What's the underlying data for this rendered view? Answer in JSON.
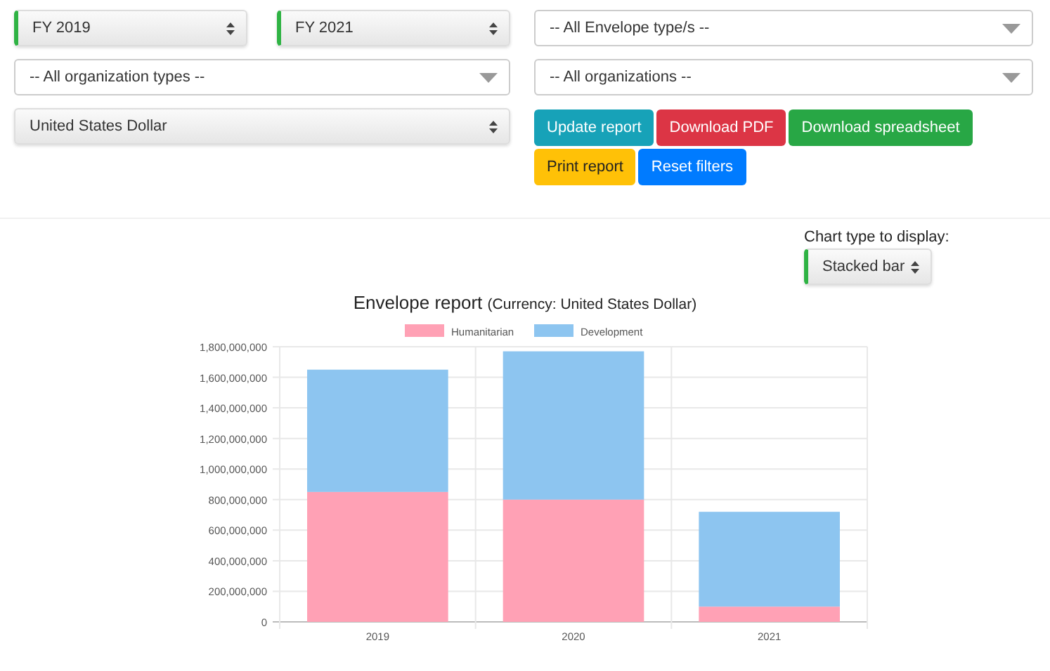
{
  "filters_left": [
    {
      "fields": [
        {
          "kind": "native",
          "value": "FY 2019",
          "highlighted": true
        },
        {
          "kind": "native",
          "value": "FY 2021",
          "highlighted": true
        }
      ]
    },
    {
      "fields": [
        {
          "kind": "dropdown",
          "value": "-- All organization types --",
          "highlighted": false
        }
      ]
    },
    {
      "fields": [
        {
          "kind": "native",
          "value": "United States Dollar",
          "highlighted": false
        }
      ]
    }
  ],
  "filters_right": [
    {
      "kind": "dropdown",
      "value": "-- All Envelope type/s --",
      "highlighted": false
    },
    {
      "kind": "dropdown",
      "value": "-- All organizations --",
      "highlighted": false
    }
  ],
  "buttons": [
    {
      "label": "Update report"
    },
    {
      "label": "Download PDF"
    },
    {
      "label": "Download spreadsheet"
    },
    {
      "label": "Print report"
    },
    {
      "label": "Reset filters"
    }
  ],
  "chart_type": {
    "label": "Chart type to display:",
    "value": "Stacked bar",
    "highlighted": true
  },
  "chart": {
    "title": "Envelope report",
    "subtitle": "(Currency: United States Dollar)",
    "chart_data": {
      "type": "bar",
      "stacked": true,
      "grid": true,
      "legend": true,
      "categories": [
        "2019",
        "2020",
        "2021"
      ],
      "series": [
        {
          "name": "Humanitarian",
          "color": "#ffa1b5",
          "values": [
            850000000,
            800000000,
            100000000
          ]
        },
        {
          "name": "Development",
          "color": "#8dc5f0",
          "values": [
            800000000,
            970000000,
            620000000
          ]
        }
      ],
      "ylim": [
        0,
        1800000000
      ],
      "yticks": [
        {
          "value": 0,
          "label": "0"
        },
        {
          "value": 200000000,
          "label": "200,000,000"
        },
        {
          "value": 400000000,
          "label": "400,000,000"
        },
        {
          "value": 600000000,
          "label": "600,000,000"
        },
        {
          "value": 800000000,
          "label": "800,000,000"
        },
        {
          "value": 1000000000,
          "label": "1,000,000,000"
        },
        {
          "value": 1200000000,
          "label": "1,200,000,000"
        },
        {
          "value": 1400000000,
          "label": "1,400,000,000"
        },
        {
          "value": 1600000000,
          "label": "1,600,000,000"
        },
        {
          "value": 1800000000,
          "label": "1,800,000,000"
        }
      ]
    }
  }
}
